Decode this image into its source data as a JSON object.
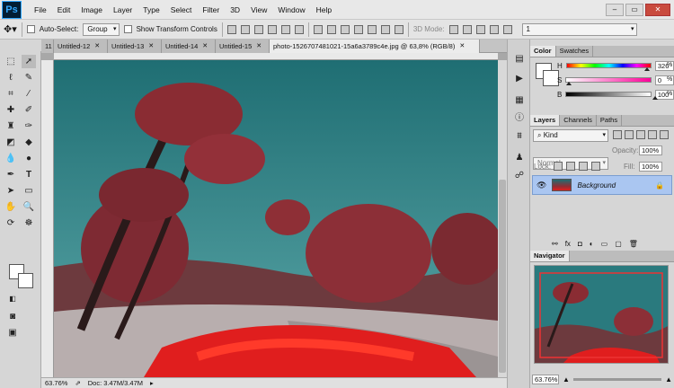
{
  "app": {
    "logo": "Ps"
  },
  "menu": [
    "File",
    "Edit",
    "Image",
    "Layer",
    "Type",
    "Select",
    "Filter",
    "3D",
    "View",
    "Window",
    "Help"
  ],
  "options": {
    "auto_select_label": "Auto-Select:",
    "auto_select_value": "Group",
    "show_transform_label": "Show Transform Controls",
    "mode_3d_label": "3D Mode:",
    "workspace_value": "1"
  },
  "tabs": [
    {
      "label": "11",
      "active": false
    },
    {
      "label": "Untitled-12",
      "active": false
    },
    {
      "label": "Untitled-13",
      "active": false
    },
    {
      "label": "Untitled-14",
      "active": false
    },
    {
      "label": "Untitled-15",
      "active": false
    },
    {
      "label": "photo-1526707481021-15a6a3789c4e.jpg @ 63,8% (RGB/8)",
      "active": true
    }
  ],
  "status": {
    "zoom": "63.76%",
    "doc": "Doc: 3.47M/3.47M"
  },
  "color_panel": {
    "tabs": [
      "Color",
      "Swatches"
    ],
    "rows": [
      {
        "label": "H",
        "value": "326",
        "pos": 0.9,
        "gradient": "linear-gradient(90deg,#f00,#ff0,#0f0,#0ff,#00f,#f0f,#f00)"
      },
      {
        "label": "S",
        "value": "0",
        "pos": 0.0,
        "gradient": "linear-gradient(90deg,#fff,#ff0099)"
      },
      {
        "label": "B",
        "value": "100",
        "pos": 1.0,
        "gradient": "linear-gradient(90deg,#000,#fff)"
      }
    ],
    "unit": "%"
  },
  "layers_panel": {
    "tabs": [
      "Layers",
      "Channels",
      "Paths"
    ],
    "kind_label": "Kind",
    "blend_mode": "Normal",
    "opacity_label": "Opacity:",
    "opacity_value": "100%",
    "lock_label": "Lock:",
    "fill_label": "Fill:",
    "fill_value": "100%",
    "layer_name": "Background"
  },
  "navigator": {
    "title": "Navigator",
    "zoom": "63.76%"
  }
}
